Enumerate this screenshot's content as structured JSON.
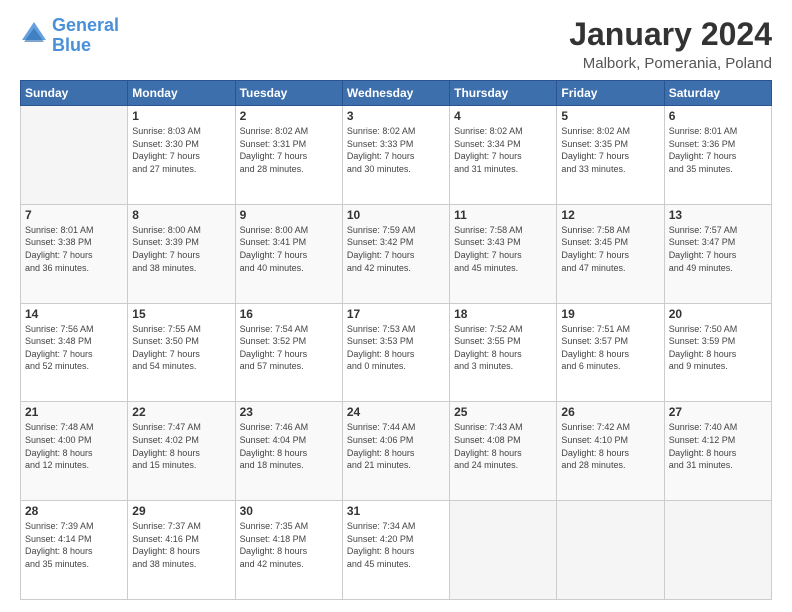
{
  "logo": {
    "text_general": "General",
    "text_blue": "Blue"
  },
  "title": "January 2024",
  "subtitle": "Malbork, Pomerania, Poland",
  "weekdays": [
    "Sunday",
    "Monday",
    "Tuesday",
    "Wednesday",
    "Thursday",
    "Friday",
    "Saturday"
  ],
  "weeks": [
    [
      {
        "day": "",
        "empty": true
      },
      {
        "day": "1",
        "sunrise": "Sunrise: 8:03 AM",
        "sunset": "Sunset: 3:30 PM",
        "daylight": "Daylight: 7 hours and 27 minutes."
      },
      {
        "day": "2",
        "sunrise": "Sunrise: 8:02 AM",
        "sunset": "Sunset: 3:31 PM",
        "daylight": "Daylight: 7 hours and 28 minutes."
      },
      {
        "day": "3",
        "sunrise": "Sunrise: 8:02 AM",
        "sunset": "Sunset: 3:33 PM",
        "daylight": "Daylight: 7 hours and 30 minutes."
      },
      {
        "day": "4",
        "sunrise": "Sunrise: 8:02 AM",
        "sunset": "Sunset: 3:34 PM",
        "daylight": "Daylight: 7 hours and 31 minutes."
      },
      {
        "day": "5",
        "sunrise": "Sunrise: 8:02 AM",
        "sunset": "Sunset: 3:35 PM",
        "daylight": "Daylight: 7 hours and 33 minutes."
      },
      {
        "day": "6",
        "sunrise": "Sunrise: 8:01 AM",
        "sunset": "Sunset: 3:36 PM",
        "daylight": "Daylight: 7 hours and 35 minutes."
      }
    ],
    [
      {
        "day": "7",
        "sunrise": "Sunrise: 8:01 AM",
        "sunset": "Sunset: 3:38 PM",
        "daylight": "Daylight: 7 hours and 36 minutes."
      },
      {
        "day": "8",
        "sunrise": "Sunrise: 8:00 AM",
        "sunset": "Sunset: 3:39 PM",
        "daylight": "Daylight: 7 hours and 38 minutes."
      },
      {
        "day": "9",
        "sunrise": "Sunrise: 8:00 AM",
        "sunset": "Sunset: 3:41 PM",
        "daylight": "Daylight: 7 hours and 40 minutes."
      },
      {
        "day": "10",
        "sunrise": "Sunrise: 7:59 AM",
        "sunset": "Sunset: 3:42 PM",
        "daylight": "Daylight: 7 hours and 42 minutes."
      },
      {
        "day": "11",
        "sunrise": "Sunrise: 7:58 AM",
        "sunset": "Sunset: 3:43 PM",
        "daylight": "Daylight: 7 hours and 45 minutes."
      },
      {
        "day": "12",
        "sunrise": "Sunrise: 7:58 AM",
        "sunset": "Sunset: 3:45 PM",
        "daylight": "Daylight: 7 hours and 47 minutes."
      },
      {
        "day": "13",
        "sunrise": "Sunrise: 7:57 AM",
        "sunset": "Sunset: 3:47 PM",
        "daylight": "Daylight: 7 hours and 49 minutes."
      }
    ],
    [
      {
        "day": "14",
        "sunrise": "Sunrise: 7:56 AM",
        "sunset": "Sunset: 3:48 PM",
        "daylight": "Daylight: 7 hours and 52 minutes."
      },
      {
        "day": "15",
        "sunrise": "Sunrise: 7:55 AM",
        "sunset": "Sunset: 3:50 PM",
        "daylight": "Daylight: 7 hours and 54 minutes."
      },
      {
        "day": "16",
        "sunrise": "Sunrise: 7:54 AM",
        "sunset": "Sunset: 3:52 PM",
        "daylight": "Daylight: 7 hours and 57 minutes."
      },
      {
        "day": "17",
        "sunrise": "Sunrise: 7:53 AM",
        "sunset": "Sunset: 3:53 PM",
        "daylight": "Daylight: 8 hours and 0 minutes."
      },
      {
        "day": "18",
        "sunrise": "Sunrise: 7:52 AM",
        "sunset": "Sunset: 3:55 PM",
        "daylight": "Daylight: 8 hours and 3 minutes."
      },
      {
        "day": "19",
        "sunrise": "Sunrise: 7:51 AM",
        "sunset": "Sunset: 3:57 PM",
        "daylight": "Daylight: 8 hours and 6 minutes."
      },
      {
        "day": "20",
        "sunrise": "Sunrise: 7:50 AM",
        "sunset": "Sunset: 3:59 PM",
        "daylight": "Daylight: 8 hours and 9 minutes."
      }
    ],
    [
      {
        "day": "21",
        "sunrise": "Sunrise: 7:48 AM",
        "sunset": "Sunset: 4:00 PM",
        "daylight": "Daylight: 8 hours and 12 minutes."
      },
      {
        "day": "22",
        "sunrise": "Sunrise: 7:47 AM",
        "sunset": "Sunset: 4:02 PM",
        "daylight": "Daylight: 8 hours and 15 minutes."
      },
      {
        "day": "23",
        "sunrise": "Sunrise: 7:46 AM",
        "sunset": "Sunset: 4:04 PM",
        "daylight": "Daylight: 8 hours and 18 minutes."
      },
      {
        "day": "24",
        "sunrise": "Sunrise: 7:44 AM",
        "sunset": "Sunset: 4:06 PM",
        "daylight": "Daylight: 8 hours and 21 minutes."
      },
      {
        "day": "25",
        "sunrise": "Sunrise: 7:43 AM",
        "sunset": "Sunset: 4:08 PM",
        "daylight": "Daylight: 8 hours and 24 minutes."
      },
      {
        "day": "26",
        "sunrise": "Sunrise: 7:42 AM",
        "sunset": "Sunset: 4:10 PM",
        "daylight": "Daylight: 8 hours and 28 minutes."
      },
      {
        "day": "27",
        "sunrise": "Sunrise: 7:40 AM",
        "sunset": "Sunset: 4:12 PM",
        "daylight": "Daylight: 8 hours and 31 minutes."
      }
    ],
    [
      {
        "day": "28",
        "sunrise": "Sunrise: 7:39 AM",
        "sunset": "Sunset: 4:14 PM",
        "daylight": "Daylight: 8 hours and 35 minutes."
      },
      {
        "day": "29",
        "sunrise": "Sunrise: 7:37 AM",
        "sunset": "Sunset: 4:16 PM",
        "daylight": "Daylight: 8 hours and 38 minutes."
      },
      {
        "day": "30",
        "sunrise": "Sunrise: 7:35 AM",
        "sunset": "Sunset: 4:18 PM",
        "daylight": "Daylight: 8 hours and 42 minutes."
      },
      {
        "day": "31",
        "sunrise": "Sunrise: 7:34 AM",
        "sunset": "Sunset: 4:20 PM",
        "daylight": "Daylight: 8 hours and 45 minutes."
      },
      {
        "day": "",
        "empty": true
      },
      {
        "day": "",
        "empty": true
      },
      {
        "day": "",
        "empty": true
      }
    ]
  ]
}
